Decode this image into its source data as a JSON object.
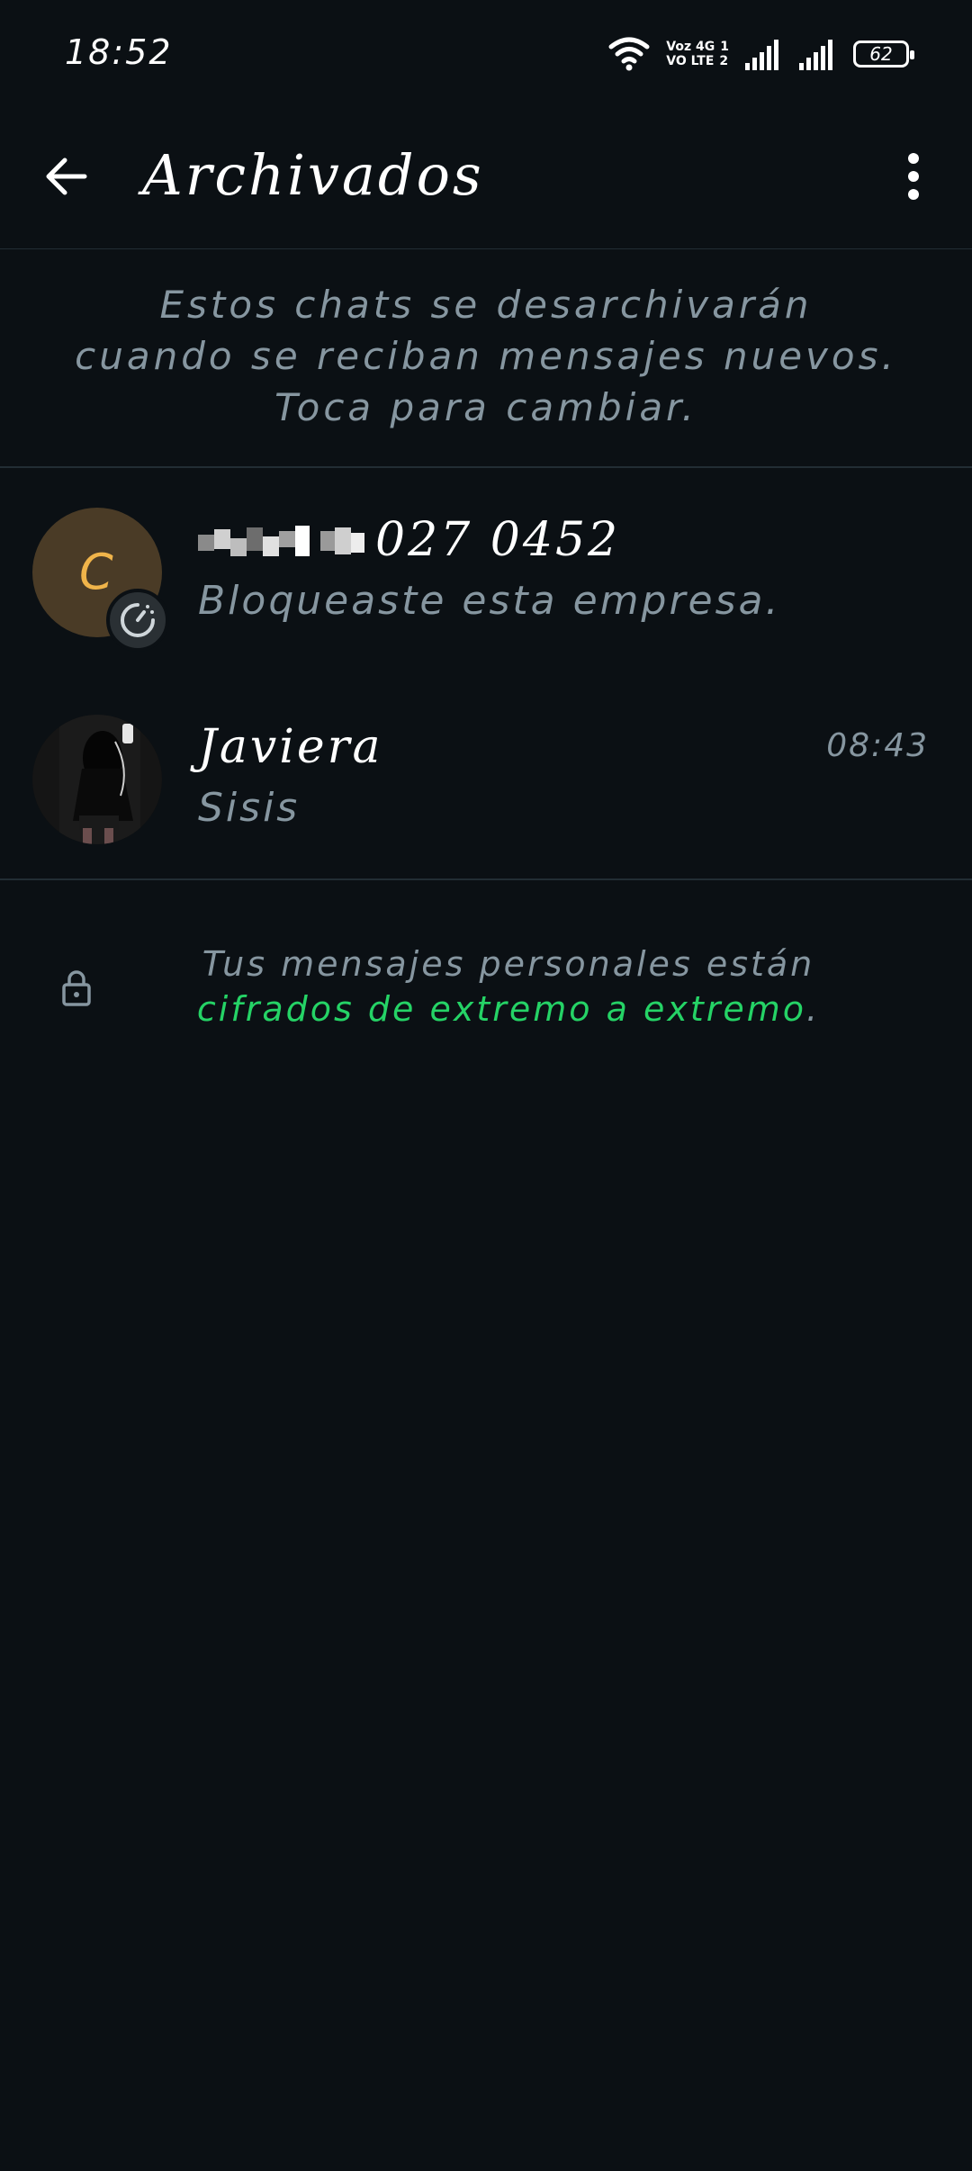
{
  "status_bar": {
    "time": "18:52",
    "network_top": "Voz 4G",
    "sim1": "1",
    "network_bottom": "VO LTE",
    "sim2": "2",
    "battery": "62"
  },
  "header": {
    "title": "Archivados",
    "back_icon": "arrow-left-icon",
    "menu_icon": "more-vert-icon"
  },
  "archive_notice": "Estos chats se desarchivarán cuando se reciban mensajes nuevos. Toca para cambiar.",
  "chats": [
    {
      "name_visible": "027 0452",
      "avatar_letter": "C",
      "preview": "Bloqueaste esta empresa.",
      "time": ""
    },
    {
      "name_visible": "Javiera",
      "preview": "Sisis",
      "time": "08:43"
    }
  ],
  "encryption_notice": {
    "text": "Tus mensajes personales están ",
    "link": "cifrados de extremo a extremo",
    "suffix": "."
  },
  "colors": {
    "background": "#0b1014",
    "accent": "#25d366",
    "secondary_text": "#8696a0"
  }
}
